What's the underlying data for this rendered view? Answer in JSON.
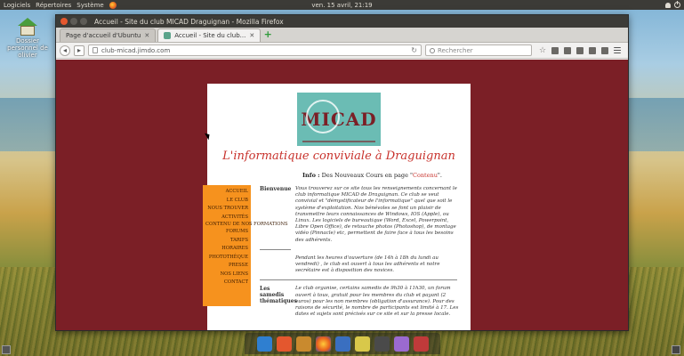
{
  "top_panel": {
    "menus": [
      "Logiciels",
      "Répertoires",
      "Système"
    ],
    "clock": "ven. 15 avril, 21:19"
  },
  "desktop": {
    "icon_label": "Dossier personnel de olivier"
  },
  "window": {
    "title": "Accueil - Site du club MICAD Draguignan - Mozilla Firefox",
    "tabs": [
      {
        "label": "Page d'accueil d'Ubuntu",
        "active": false
      },
      {
        "label": "Accueil - Site du club...",
        "active": true
      }
    ],
    "url": "club-micad.jimdo.com",
    "search_placeholder": "Rechercher"
  },
  "page": {
    "logo_text": "MICAD",
    "title": "L'informatique conviviale à Draguignan",
    "info": {
      "prefix": "Info :",
      "text": "Des Nouveaux Cours en page \"",
      "link": "Contenu",
      "suffix": "\"."
    },
    "menu": [
      "ACCUEIL",
      "LE CLUB",
      "NOUS TROUVER",
      "ACTIVITÉS",
      "CONTENU DE NOS FORMATIONS",
      "FORUMS",
      "TARIFS",
      "HORAIRES",
      "PHOTOTHÈQUE",
      "PRESSE",
      "NOS LIENS",
      "CONTACT"
    ],
    "sections": [
      {
        "label": "Bienvenue",
        "text": "Vous trouverez sur ce site tous les renseignements concernant le club informatique MICAD de Draguignan. Ce club se veut convivial et \"démystificateur de l'informatique\" quel que soit le système d'exploitation. Nos bénévoles se font un plaisir de transmettre leurs connaissances de Windows, IOS (Apple), ou Linux. Les logiciels de bureautique (Word, Excel, Powerpoint, Libre Open Office), de retouche photos (Photoshop), de montage vidéo (Pinnacle) etc, permettent de faire face à tous les besoins des adhérents."
      },
      {
        "label": "",
        "text": "Pendant les heures d'ouverture (de 14h à 18h du lundi au vendredi) , le club est ouvert à tous les adhérents et notre secrétaire est à disposition des novices."
      },
      {
        "label": "Les samedis thématiques",
        "text": "Le club organise, certains samedis de 9h30 à 11h30, un forum ouvert à tous, gratuit pour les membres du club et payant (2 euros) pour les non membres (obligation d'assurance). Pour des raisons de sécurité, le nombre de participants est limité à 17. Les dates et sujets sont précisés sur ce site et sur la presse locale."
      }
    ]
  },
  "colors": {
    "page_background": "#7b1f26",
    "menu_background": "#f6921e",
    "title_color": "#c8322c",
    "logo_background": "#6bbcb4"
  }
}
